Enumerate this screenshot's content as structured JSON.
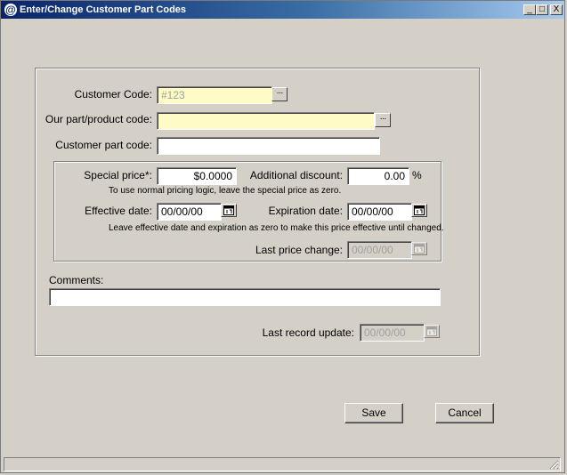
{
  "window": {
    "title": "Enter/Change Customer Part Codes",
    "app_icon": "@",
    "controls": {
      "minimize": "_",
      "maximize": "□",
      "close": "X"
    }
  },
  "form": {
    "customer_code": {
      "label": "Customer Code:",
      "value": "#123",
      "lookup_label": "···"
    },
    "our_part": {
      "label": "Our part/product code:",
      "value": "",
      "lookup_label": "···"
    },
    "customer_part": {
      "label": "Customer part code:",
      "value": ""
    },
    "pricing": {
      "special_price": {
        "label": "Special price*:",
        "value": "$0.0000"
      },
      "additional_discount": {
        "label": "Additional discount:",
        "value": "0.00",
        "unit": "%"
      },
      "price_note": "To use normal pricing logic, leave the special price as zero.",
      "effective_date": {
        "label": "Effective date:",
        "value": "00/00/00"
      },
      "expiration_date": {
        "label": "Expiration date:",
        "value": "00/00/00"
      },
      "date_note": "Leave effective date and expiration as zero to make this price effective until changed.",
      "last_price_change": {
        "label": "Last price change:",
        "value": "00/00/00"
      }
    },
    "comments": {
      "label": "Comments:",
      "value": ""
    },
    "last_record_update": {
      "label": "Last record update:",
      "value": "00/00/00"
    }
  },
  "buttons": {
    "save": "Save",
    "cancel": "Cancel"
  },
  "icons": {
    "calendar": "calendar-icon",
    "lookup": "ellipsis-icon"
  }
}
